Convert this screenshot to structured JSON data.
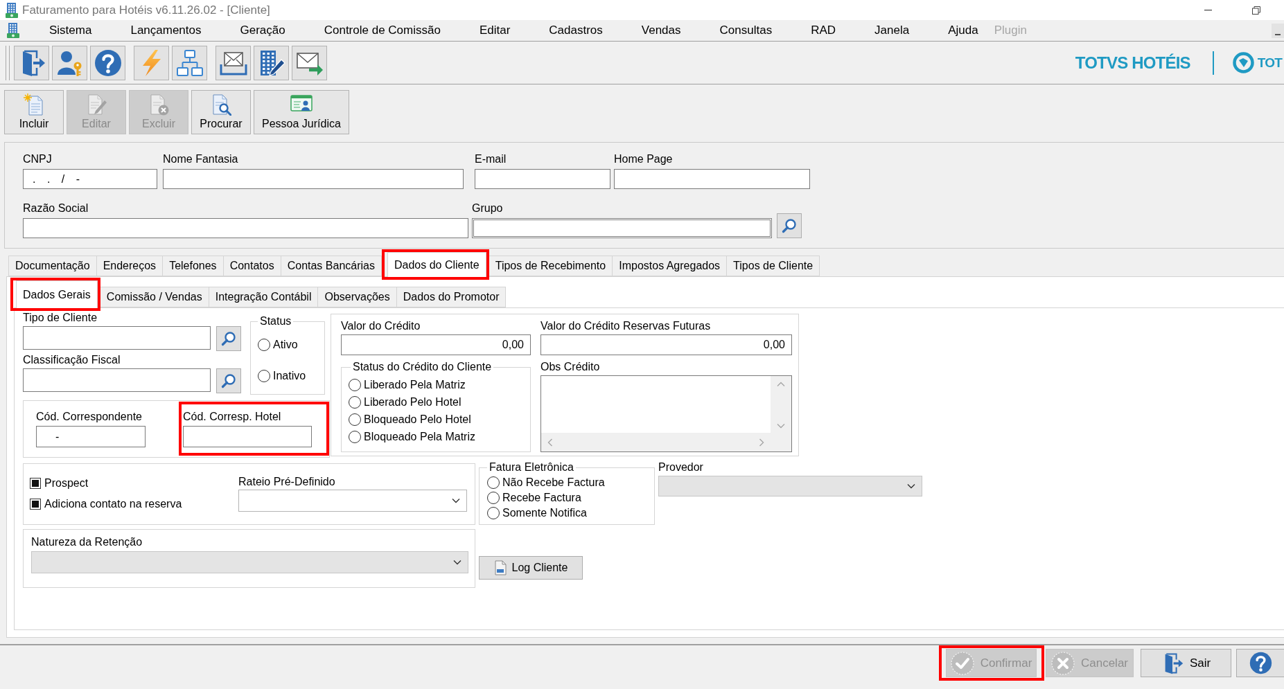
{
  "window": {
    "title": "Faturamento para Hotéis v6.11.26.02 - [Cliente]"
  },
  "menu_bar": [
    {
      "label": "Sistema",
      "disabled": false
    },
    {
      "label": "Lançamentos",
      "disabled": false
    },
    {
      "label": "Geração",
      "disabled": false
    },
    {
      "label": "Controle de Comissão",
      "disabled": false
    },
    {
      "label": "Editar",
      "disabled": false
    },
    {
      "label": "Cadastros",
      "disabled": false
    },
    {
      "label": "Vendas",
      "disabled": false
    },
    {
      "label": "Consultas",
      "disabled": false
    },
    {
      "label": "RAD",
      "disabled": false
    },
    {
      "label": "Janela",
      "disabled": false
    },
    {
      "label": "Ajuda",
      "disabled": false
    },
    {
      "label": "Plugin",
      "disabled": true
    }
  ],
  "brand": {
    "name": "TOTVS HOTÉIS",
    "logo_text": "TOT"
  },
  "record_toolbar": [
    {
      "label": "Incluir",
      "disabled": false
    },
    {
      "label": "Editar",
      "disabled": true
    },
    {
      "label": "Excluir",
      "disabled": true
    },
    {
      "label": "Procurar",
      "disabled": false
    },
    {
      "label": "Pessoa Jurídica",
      "disabled": false
    }
  ],
  "header": [
    [
      {
        "label": "CNPJ",
        "value": ". . / -",
        "kind": "text",
        "focused": false
      },
      {
        "label": "Nome Fantasia",
        "kind": "text",
        "focused": false
      },
      {
        "label": "E-mail",
        "kind": "text",
        "focused": false
      },
      {
        "label": "Home Page",
        "kind": "text",
        "focused": false
      }
    ],
    [
      {
        "label": "Razão Social",
        "kind": "text",
        "focused": false
      },
      {
        "label": "Grupo",
        "kind": "lookup",
        "focused": true
      }
    ]
  ],
  "tabs": [
    {
      "label": "Documentação",
      "selected": false,
      "highlighted": false
    },
    {
      "label": "Endereços",
      "selected": false,
      "highlighted": false
    },
    {
      "label": "Telefones",
      "selected": false,
      "highlighted": false
    },
    {
      "label": "Contatos",
      "selected": false,
      "highlighted": false
    },
    {
      "label": "Contas Bancárias",
      "selected": false,
      "highlighted": false
    },
    {
      "label": "Dados do Cliente",
      "selected": true,
      "highlighted": true
    },
    {
      "label": "Tipos de Recebimento",
      "selected": false,
      "highlighted": false
    },
    {
      "label": "Impostos Agregados",
      "selected": false,
      "highlighted": false
    },
    {
      "label": "Tipos de Cliente",
      "selected": false,
      "highlighted": false
    }
  ],
  "sub_tabs": [
    {
      "label": "Dados Gerais",
      "selected": true,
      "highlighted": true
    },
    {
      "label": "Comissão / Vendas",
      "selected": false,
      "highlighted": false
    },
    {
      "label": "Integração Contábil",
      "selected": false,
      "highlighted": false
    },
    {
      "label": "Observações",
      "selected": false,
      "highlighted": false
    },
    {
      "label": "Dados do Promotor",
      "selected": false,
      "highlighted": false
    }
  ],
  "general": {
    "lookups": [
      {
        "label": "Tipo de Cliente"
      },
      {
        "label": "Classificação Fiscal"
      }
    ],
    "status": {
      "title": "Status",
      "options": [
        {
          "label": "Ativo",
          "selected": false
        },
        {
          "label": "Inativo",
          "selected": false
        }
      ]
    },
    "codes": [
      {
        "label": "Cód. Correspondente",
        "value": "-",
        "highlighted": false
      },
      {
        "label": "Cód. Corresp. Hotel",
        "highlighted": true
      }
    ],
    "credit": {
      "amount": {
        "label": "Valor do Crédito",
        "value": "0,00"
      },
      "future_amount": {
        "label": "Valor do Crédito Reservas Futuras",
        "value": "0,00"
      },
      "status": {
        "title": "Status do Crédito do Cliente",
        "options": [
          {
            "label": "Liberado Pela Matriz",
            "selected": false
          },
          {
            "label": "Liberado Pelo Hotel",
            "selected": false
          },
          {
            "label": "Bloqueado Pelo Hotel",
            "selected": false
          },
          {
            "label": "Bloqueado Pela Matriz",
            "selected": false
          }
        ]
      },
      "notes": {
        "label": "Obs Crédito"
      }
    },
    "flags": [
      {
        "label": "Prospect",
        "checked": true
      },
      {
        "label": "Adiciona contato na reserva",
        "checked": true
      }
    ],
    "rateio": {
      "label": "Rateio Pré-Definido",
      "disabled": false
    },
    "invoice": {
      "title": "Fatura Eletrônica",
      "options": [
        {
          "label": "Não Recebe Factura",
          "selected": false
        },
        {
          "label": "Recebe Factura",
          "selected": false
        },
        {
          "label": "Somente Notifica",
          "selected": false
        }
      ]
    },
    "provider": {
      "label": "Provedor",
      "disabled": true
    },
    "withholding": {
      "label": "Natureza da Retenção",
      "disabled": true
    },
    "log_button": {
      "label": "Log Cliente"
    }
  },
  "footer": [
    {
      "label": "Confirmar",
      "disabled": true,
      "highlighted": true
    },
    {
      "label": "Cancelar",
      "disabled": true,
      "highlighted": false
    },
    {
      "label": "Sair",
      "disabled": false,
      "highlighted": false
    },
    {
      "disabled": false,
      "highlighted": false
    }
  ]
}
